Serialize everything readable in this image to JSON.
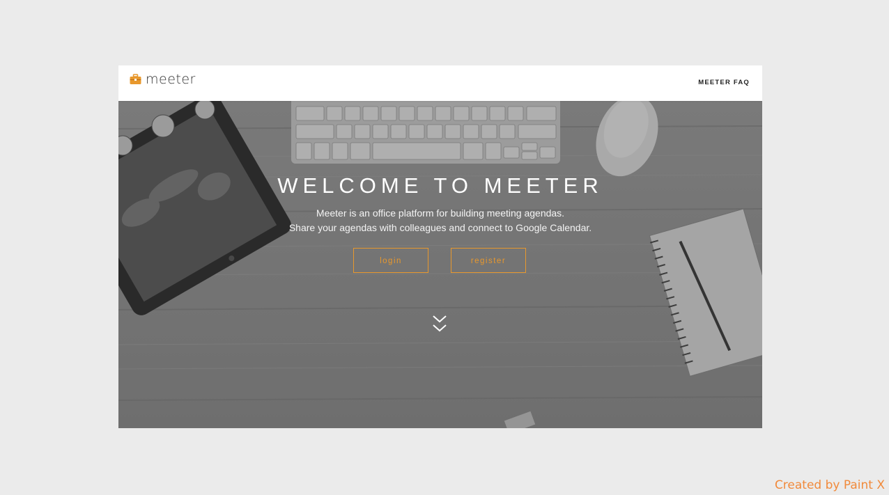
{
  "brand": {
    "name": "meeter",
    "icon": "briefcase-icon",
    "accent_color": "#e8982d"
  },
  "nav": {
    "faq_label": "MEETER FAQ"
  },
  "hero": {
    "title": "WELCOME TO MEETER",
    "subtitle_line1": "Meeter is an office platform for building meeting agendas.",
    "subtitle_line2": "Share your agendas with colleagues and connect to Google Calendar.",
    "login_label": "login",
    "register_label": "register",
    "scroll_icon": "double-chevron-down-icon"
  },
  "watermark": "Created by Paint X"
}
